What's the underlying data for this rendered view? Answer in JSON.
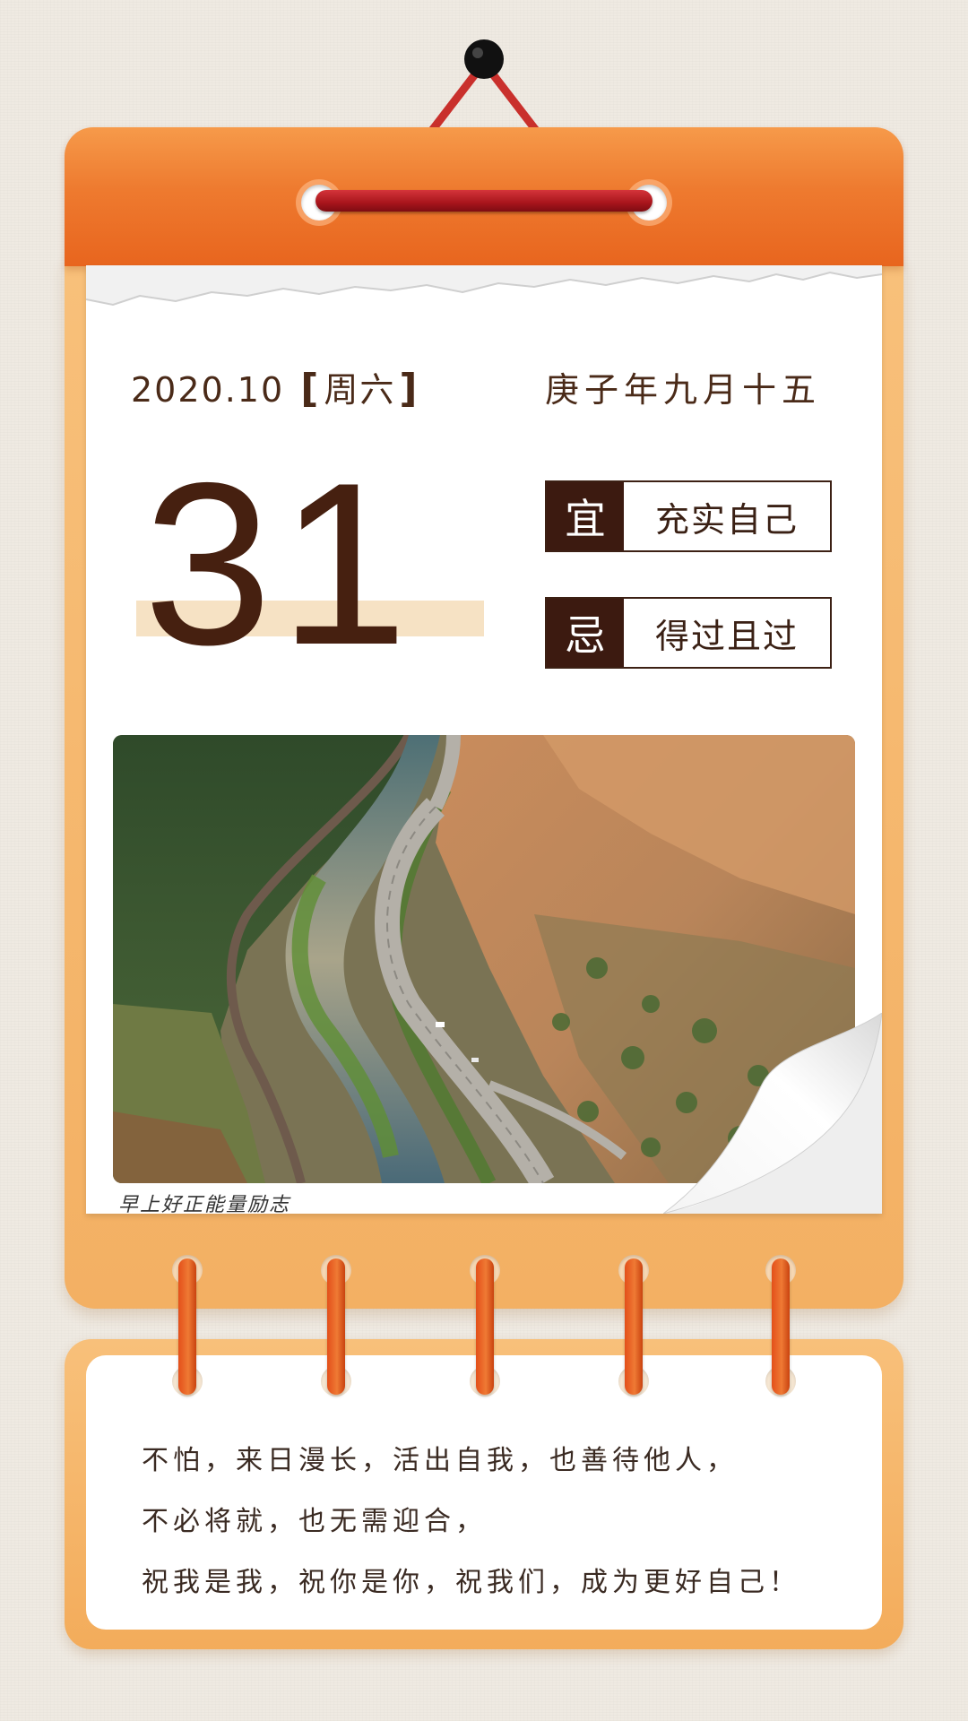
{
  "header": {
    "date": "2020.10",
    "bracket_open": "[",
    "weekday": "周六",
    "bracket_close": "]",
    "lunar_date": "庚子年九月十五"
  },
  "day": "31",
  "almanac": {
    "yi_label": "宜",
    "yi_text": "充实自己",
    "ji_label": "忌",
    "ji_text": "得过且过"
  },
  "photo": {
    "caption": "早上好正能量励志"
  },
  "quote": {
    "line1": "不怕，来日漫长，活出自我，也善待他人，",
    "line2": "不必将就，也无需迎合，",
    "line3": "祝我是我，祝你是你，祝我们，成为更好自己！"
  },
  "colors": {
    "orange_bar": "#ee7a2f",
    "frame": "#f8c07a",
    "rod": "#a8151c",
    "text_dark": "#462010"
  }
}
